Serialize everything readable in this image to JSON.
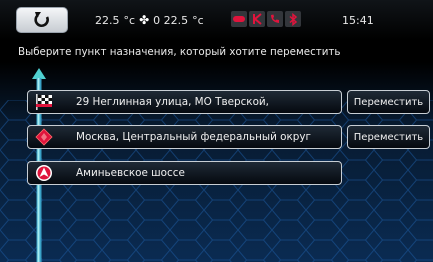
{
  "status_bar": {
    "climate_left": "22.5",
    "climate_right": "0 22.5",
    "degree_unit": "°c",
    "clock": "15:41",
    "icons": [
      "back-icon",
      "fan-icon",
      "infinity-icon",
      "k-icon",
      "phone-icon",
      "bluetooth-icon"
    ]
  },
  "instruction": "Выберите пункт назначения, который хотите переместить",
  "destinations": [
    {
      "icon": "checkered-flag-icon",
      "label": "29 Неглинная улица, МО Тверской,",
      "action": "Переместить"
    },
    {
      "icon": "red-diamond-waypoint-icon",
      "label": "Москва, Центральный федеральный округ",
      "action": "Переместить"
    },
    {
      "icon": "start-position-icon",
      "label": "Аминьевское шоссе"
    }
  ],
  "colors": {
    "accent": "#e0143c",
    "frame": "#c8ced4",
    "text": "#f0f0f0"
  }
}
